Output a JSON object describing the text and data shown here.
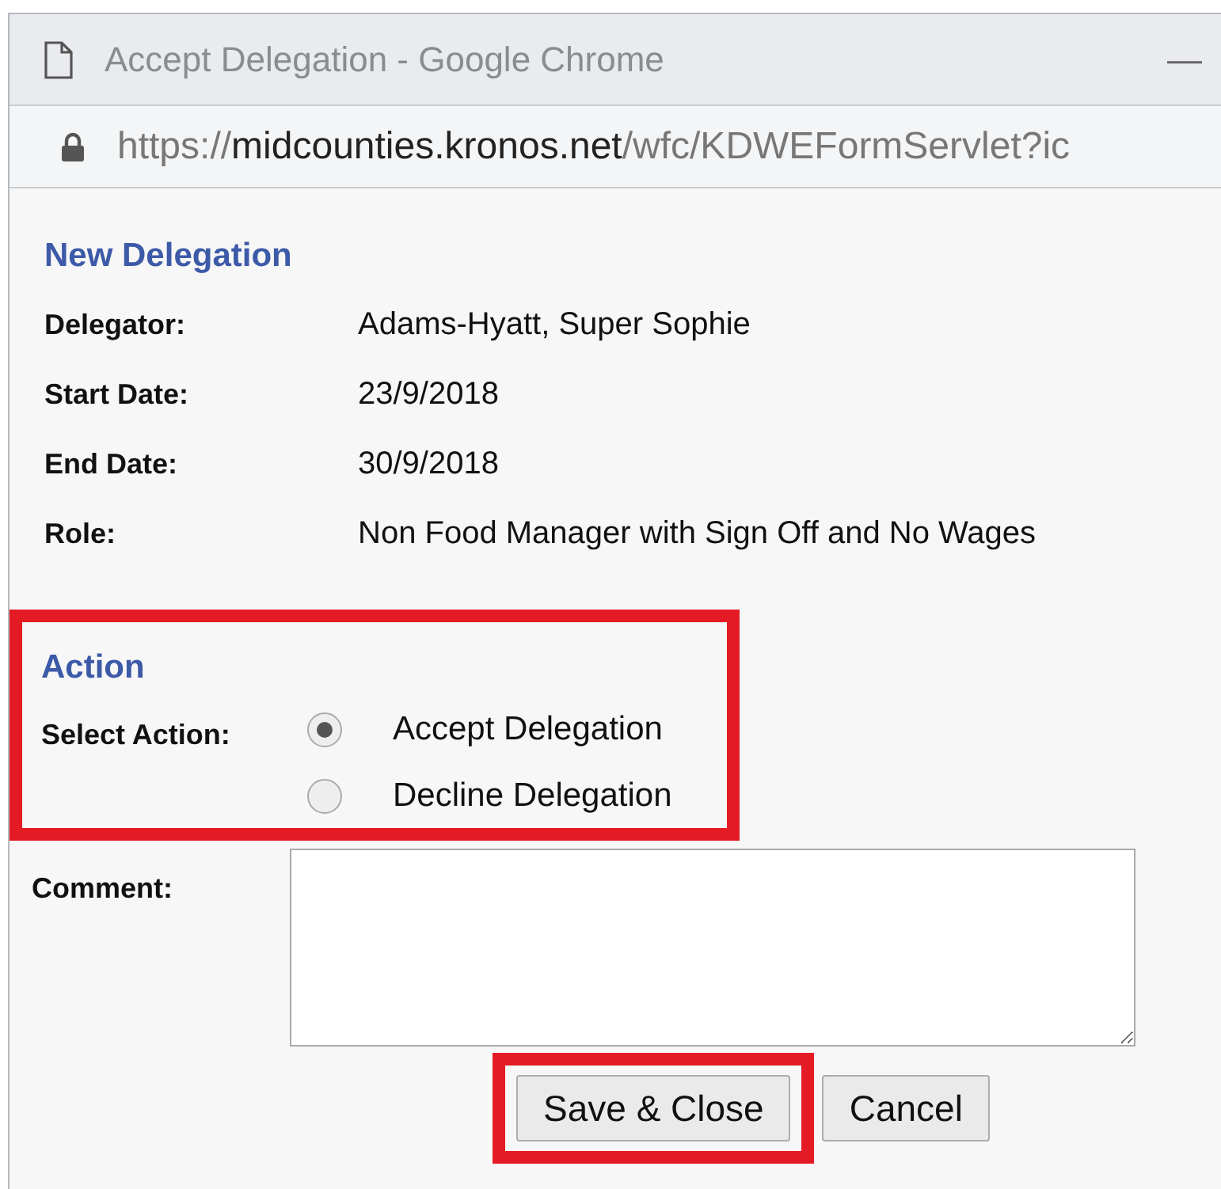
{
  "window": {
    "title": "Accept Delegation - Google Chrome",
    "minimize": "—"
  },
  "address_bar": {
    "scheme": "https://",
    "host": "midcounties.kronos.net",
    "path": "/wfc/KDWEFormServlet?ic"
  },
  "delegation": {
    "heading": "New Delegation",
    "fields": [
      {
        "label": "Delegator:",
        "value": "Adams-Hyatt, Super Sophie"
      },
      {
        "label": "Start Date:",
        "value": "23/9/2018"
      },
      {
        "label": "End Date:",
        "value": "30/9/2018"
      },
      {
        "label": "Role:",
        "value": "Non Food Manager with Sign Off and No Wages"
      }
    ]
  },
  "action": {
    "heading": "Action",
    "highlighted": true,
    "label": "Select Action:",
    "options": [
      {
        "label": "Accept Delegation",
        "selected": true
      },
      {
        "label": "Decline Delegation",
        "selected": false
      }
    ]
  },
  "comment": {
    "label": "Comment:"
  },
  "buttons": [
    {
      "label": "Save & Close",
      "highlighted": true
    },
    {
      "label": "Cancel",
      "highlighted": false
    }
  ]
}
